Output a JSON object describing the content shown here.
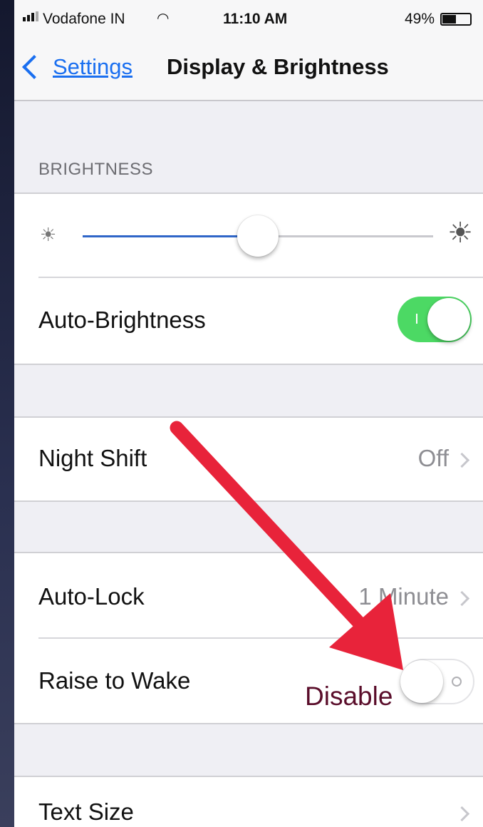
{
  "status_bar": {
    "carrier": "Vodafone IN",
    "time": "11:10 AM",
    "battery": "49%",
    "battery_level": 0.49
  },
  "nav": {
    "back_label": "Settings",
    "title": "Display & Brightness"
  },
  "brightness": {
    "header": "BRIGHTNESS",
    "slider_value": 0.5,
    "auto_label": "Auto-Brightness",
    "auto_on": true
  },
  "night_shift": {
    "label": "Night Shift",
    "value": "Off"
  },
  "lock": {
    "auto_lock_label": "Auto-Lock",
    "auto_lock_value": "1 Minute",
    "raise_label": "Raise to Wake",
    "raise_on": false
  },
  "text_size": {
    "label": "Text Size"
  },
  "annotation": {
    "text": "Disable",
    "arrow_color": "#e8233a"
  },
  "colors": {
    "accent": "#1a6ff0",
    "toggle_on": "#4cd964"
  }
}
